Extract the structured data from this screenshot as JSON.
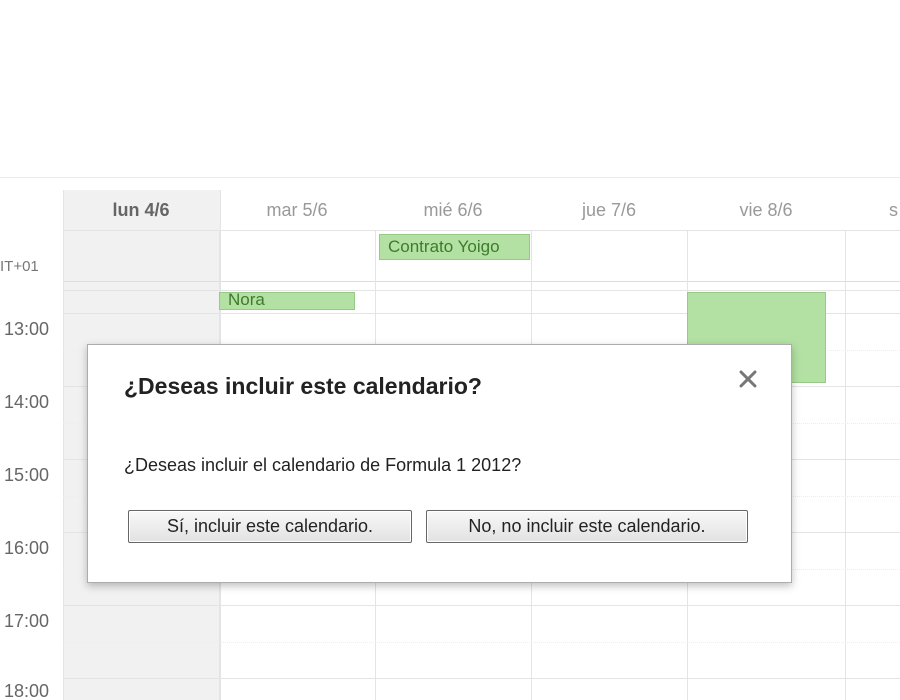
{
  "calendar": {
    "timezone_label": "IT+01",
    "days": [
      {
        "label": "lun 4/6",
        "today": true
      },
      {
        "label": "mar 5/6",
        "today": false
      },
      {
        "label": "mié 6/6",
        "today": false
      },
      {
        "label": "jue 7/6",
        "today": false
      },
      {
        "label": "vie 8/6",
        "today": false
      },
      {
        "label": "s",
        "today": false
      }
    ],
    "times": [
      "13:00",
      "14:00",
      "15:00",
      "16:00",
      "17:00",
      "18:00"
    ],
    "events": [
      {
        "title": "Contrato Yoigo",
        "day": "mié 6/6",
        "all_day": true
      },
      {
        "title": "Nora",
        "day": "mar 5/6",
        "all_day": false
      },
      {
        "title": "",
        "day": "vie 8/6",
        "all_day": false
      }
    ],
    "event_color": "#b3e1a3"
  },
  "dialog": {
    "title": "¿Deseas incluir este calendario?",
    "message": "¿Deseas incluir el calendario de Formula 1 2012?",
    "confirm_label": "Sí, incluir este calendario.",
    "cancel_label": "No, no incluir este calendario.",
    "close_icon": "close-icon"
  }
}
